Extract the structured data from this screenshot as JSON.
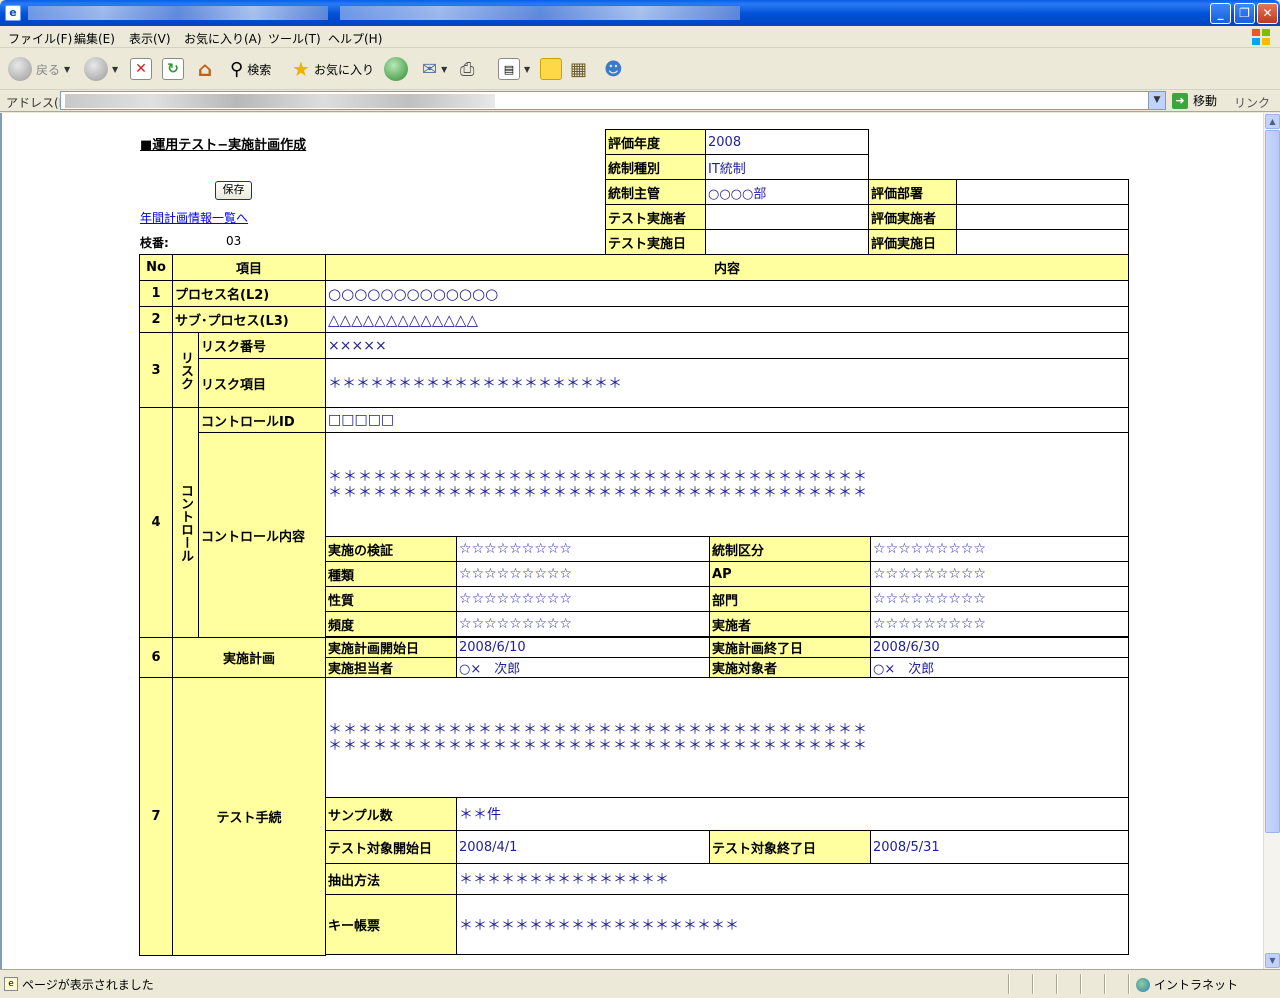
{
  "browser": {
    "menu": [
      "ファイル(F)",
      "編集(E)",
      "表示(V)",
      "お気に入り(A)",
      "ツール(T)",
      "ヘルプ(H)"
    ],
    "toolbar": {
      "back": "戻る",
      "search": "検索",
      "favorites": "お気に入り"
    },
    "address_label": "アドレス(D)",
    "go_label": "移動",
    "links_label": "リンク",
    "status_text": "ページが表示されました",
    "zone_label": "イントラネット"
  },
  "page": {
    "title": "■運用テスト−実施計画作成",
    "save_label": "保存",
    "plan_link": "年間計画情報一覧へ",
    "branch_label": "枝番:",
    "branch_value": "03"
  },
  "info": {
    "year_label": "評価年度",
    "year_value": "2008",
    "control_type_label": "統制種別",
    "control_type_value": "IT統制",
    "control_owner_label": "統制主管",
    "control_owner_value": "○○○○部",
    "eval_dept_label": "評価部署",
    "eval_dept_value": "",
    "tester_label": "テスト実施者",
    "tester_value": "",
    "evaluator_label": "評価実施者",
    "evaluator_value": "",
    "test_date_label": "テスト実施日",
    "test_date_value": "",
    "eval_date_label": "評価実施日",
    "eval_date_value": ""
  },
  "header": {
    "no": "No",
    "item": "項目",
    "content": "内容"
  },
  "rows": {
    "r1": {
      "no": "1",
      "label": "プロセス名(L2)",
      "value": "○○○○○○○○○○○○○"
    },
    "r2": {
      "no": "2",
      "label": "サブ･プロセス(L3)",
      "value": "△△△△△△△△△△△△△"
    },
    "r3": {
      "no": "3",
      "group": "リスク",
      "risk_no_label": "リスク番号",
      "risk_no_value": "×××××",
      "risk_item_label": "リスク項目",
      "risk_item_value": "＊＊＊＊＊＊＊＊＊＊＊＊＊＊＊＊＊＊＊＊＊"
    },
    "r4": {
      "no": "4",
      "group": "コントロール",
      "id_label": "コントロールID",
      "id_value": "□□□□□",
      "content_label": "コントロール内容",
      "content_line1": "＊＊＊＊＊＊＊＊＊＊＊＊＊＊＊＊＊＊＊＊＊＊＊＊＊＊＊＊＊＊＊＊＊＊＊＊",
      "content_line2": "＊＊＊＊＊＊＊＊＊＊＊＊＊＊＊＊＊＊＊＊＊＊＊＊＊＊＊＊＊＊＊＊＊＊＊＊",
      "verify_label": "実施の検証",
      "verify_value": "☆☆☆☆☆☆☆☆☆",
      "category_label": "統制区分",
      "category_value": "☆☆☆☆☆☆☆☆☆",
      "kind_label": "種類",
      "kind_value": "☆☆☆☆☆☆☆☆☆",
      "ap_label": "AP",
      "ap_value": "☆☆☆☆☆☆☆☆☆",
      "nature_label": "性質",
      "nature_value": "☆☆☆☆☆☆☆☆☆",
      "dept_label": "部門",
      "dept_value": "☆☆☆☆☆☆☆☆☆",
      "freq_label": "頻度",
      "freq_value": "☆☆☆☆☆☆☆☆☆",
      "executor_label": "実施者",
      "executor_value": "☆☆☆☆☆☆☆☆☆"
    },
    "r6": {
      "no": "6",
      "label": "実施計画",
      "start_label": "実施計画開始日",
      "start_value": "2008/6/10",
      "end_label": "実施計画終了日",
      "end_value": "2008/6/30",
      "person_label": "実施担当者",
      "person_value": "○×　次郎",
      "target_label": "実施対象者",
      "target_value": "○×　次郎"
    },
    "r7": {
      "no": "7",
      "label": "テスト手続",
      "proc_line1": "＊＊＊＊＊＊＊＊＊＊＊＊＊＊＊＊＊＊＊＊＊＊＊＊＊＊＊＊＊＊＊＊＊＊＊＊",
      "proc_line2": "＊＊＊＊＊＊＊＊＊＊＊＊＊＊＊＊＊＊＊＊＊＊＊＊＊＊＊＊＊＊＊＊＊＊＊＊",
      "sample_label": "サンプル数",
      "sample_value": "＊＊件",
      "tstart_label": "テスト対象開始日",
      "tstart_value": "2008/4/1",
      "tend_label": "テスト対象終了日",
      "tend_value": "2008/5/31",
      "extract_label": "抽出方法",
      "extract_value": "＊＊＊＊＊＊＊＊＊＊＊＊＊＊＊",
      "key_label": "キー帳票",
      "key_value": "＊＊＊＊＊＊＊＊＊＊＊＊＊＊＊＊＊＊＊＊"
    }
  }
}
